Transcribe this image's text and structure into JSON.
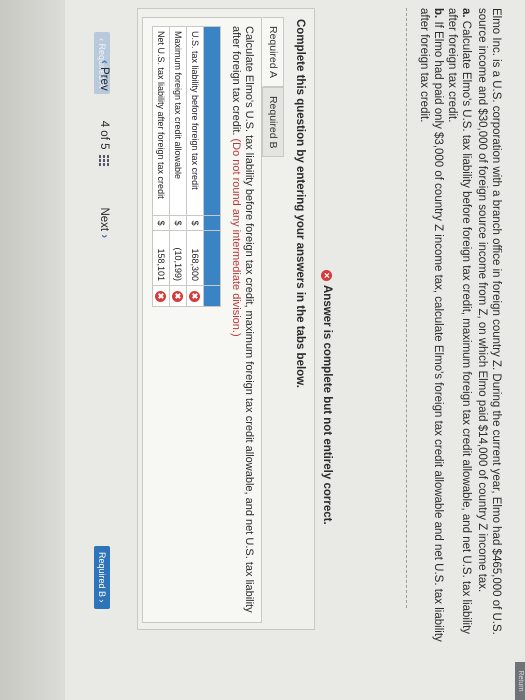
{
  "problem": {
    "intro": "Elmo Inc. is a U.S. corporation with a branch office in foreign country Z. During the current year, Elmo had $465,000 of U.S. source income and $30,000 of foreign source income from Z, on which Elmo paid $14,000 of country Z income tax.",
    "part_a_letter": "a.",
    "part_a": "Calculate Elmo's U.S. tax liability before foreign tax credit, maximum foreign tax credit allowable, and net U.S. tax liability after foreign tax credit.",
    "part_b_letter": "b.",
    "part_b": "If Elmo had paid only $3,000 of country Z income tax, calculate Elmo's foreign tax credit allowable and net U.S. tax liability after foreign tax credit."
  },
  "status_message": "Answer is complete but not entirely correct.",
  "instructions": "Complete this question by entering your answers in the tabs below.",
  "tabs": [
    {
      "label": "Required A"
    },
    {
      "label": "Required B"
    }
  ],
  "prompt_text": "Calculate Elmo's U.S. tax liability before foreign tax credit, maximum foreign tax credit allowable, and net U.S. tax liability after foreign tax credit.",
  "prompt_note": "(Do not round any intermediate division.)",
  "rows": [
    {
      "label": "U.S. tax liability before foreign tax credit",
      "currency": "$",
      "value": "168,300",
      "mark": "✖"
    },
    {
      "label": "Maximum foreign tax credit allowable",
      "currency": "$",
      "value": "(10,199)",
      "mark": "✖"
    },
    {
      "label": "Net U.S. tax liability after foreign tax credit",
      "currency": "$",
      "value": "158,101",
      "mark": "✖"
    }
  ],
  "nav_buttons": {
    "prev": "‹ Required A",
    "next": "Required B ›"
  },
  "pager": {
    "prev": "Prev",
    "page": "4 of 5",
    "next": "Next"
  },
  "corner_label": "Return"
}
